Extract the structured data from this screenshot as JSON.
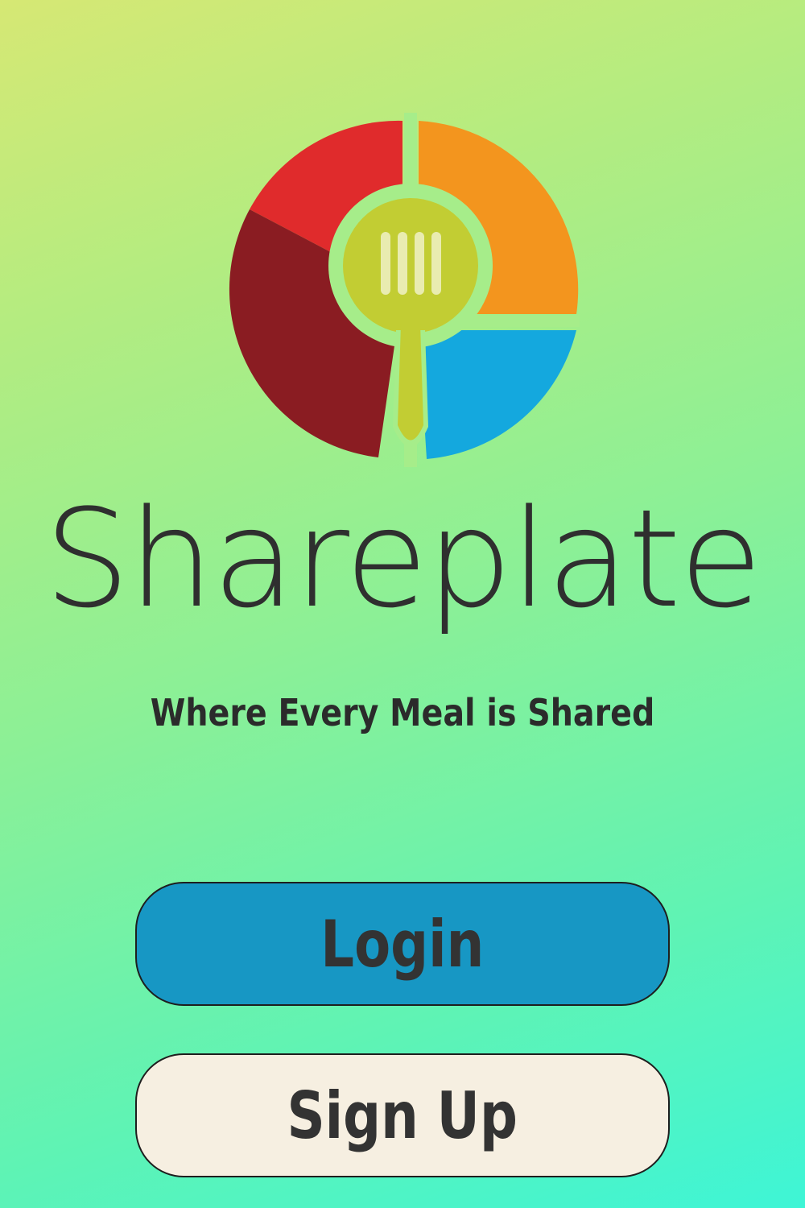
{
  "app": {
    "name": "Shareplate",
    "tagline": "Where Every Meal is Shared"
  },
  "logo": {
    "icon": "plate-fork-icon",
    "colors": {
      "red": "#e02b2c",
      "dark_red": "#8a1c22",
      "orange": "#f3951e",
      "blue": "#14a8de",
      "green": "#c2cd33",
      "wordmark": "#2f2f2f"
    }
  },
  "actions": {
    "login_label": "Login",
    "signup_label": "Sign Up"
  },
  "colors": {
    "login_button": "#1797c4",
    "signup_button": "#f6efe1",
    "background_top": "#d6e874",
    "background_bottom": "#3ef5d6"
  }
}
